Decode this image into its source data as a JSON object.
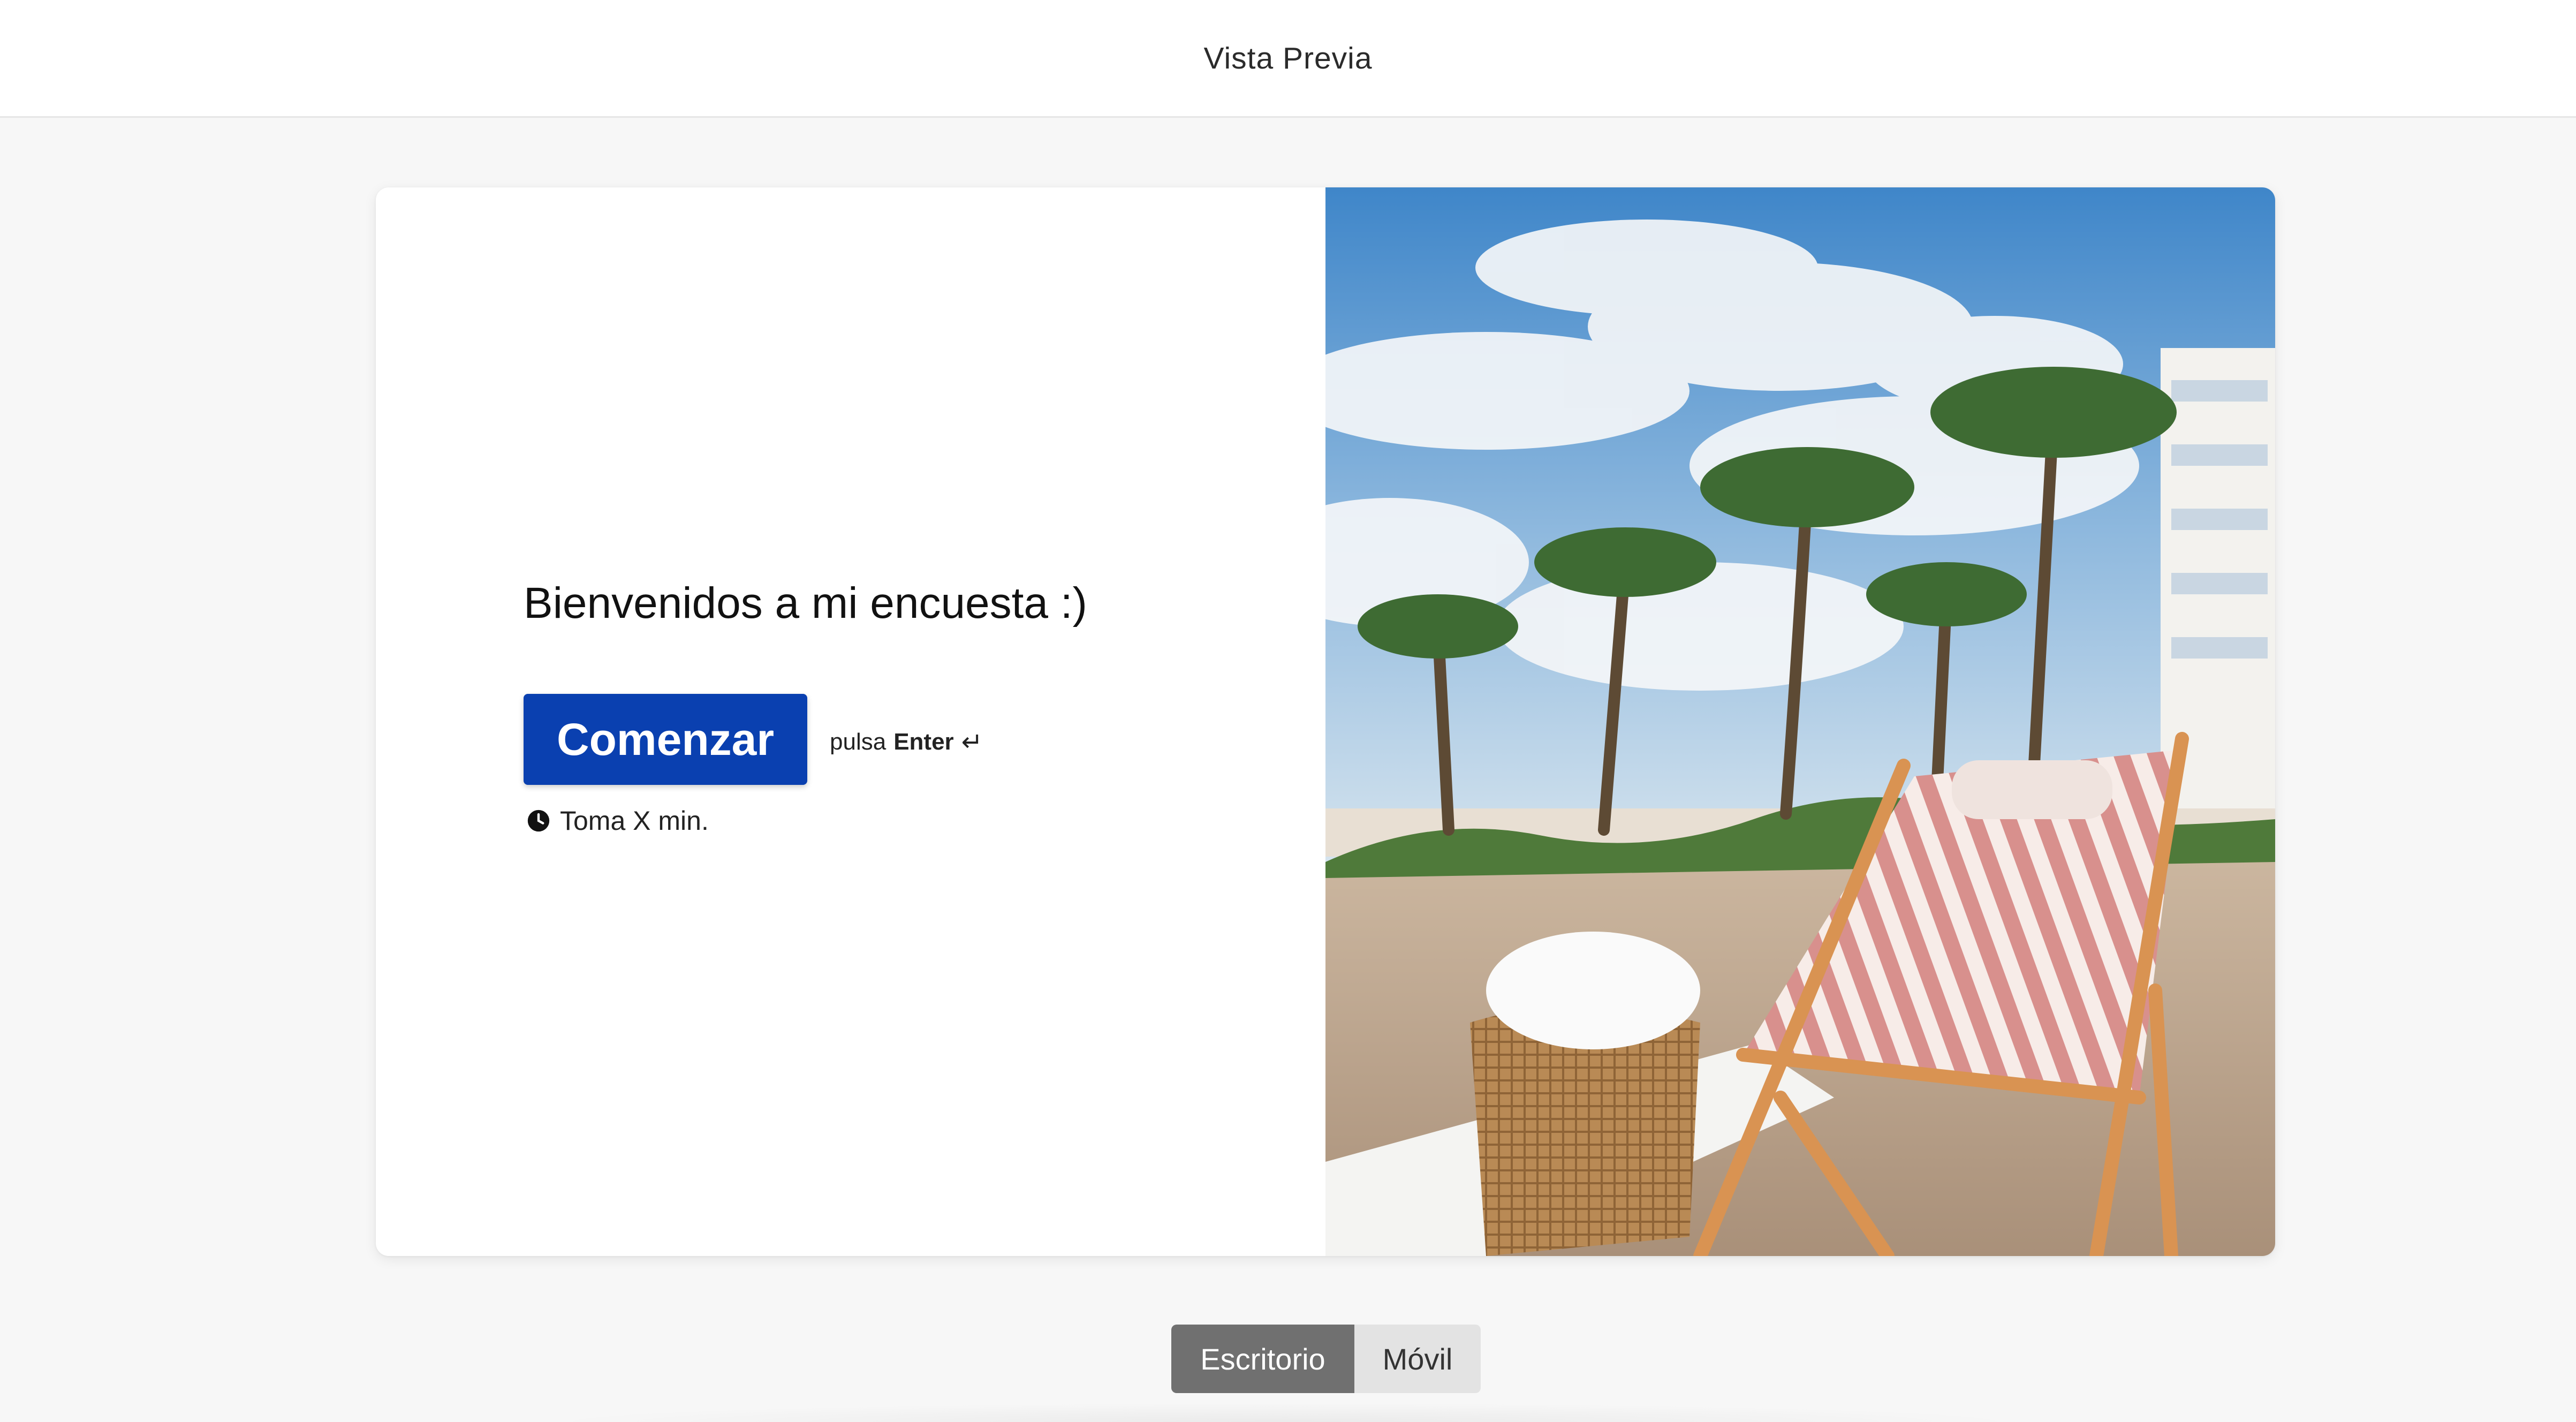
{
  "header": {
    "title": "Vista Previa"
  },
  "welcome_screen": {
    "heading": "Bienvenidos a mi encuesta :)",
    "start_button_label": "Comenzar",
    "hint_prefix": "pulsa",
    "hint_key": "Enter",
    "hint_symbol": "↵",
    "duration_text": "Toma X min.",
    "duration_icon": "clock-icon",
    "image": "beach-lounge-chair-with-palm-trees-photo"
  },
  "device_toggle": {
    "options": [
      "Escritorio",
      "Móvil"
    ],
    "selected": "Escritorio"
  },
  "colors": {
    "primary_button": "#0a40b0",
    "toggle_active": "#707070",
    "toggle_inactive": "#e3e3e3",
    "page_background": "#f7f7f7"
  }
}
